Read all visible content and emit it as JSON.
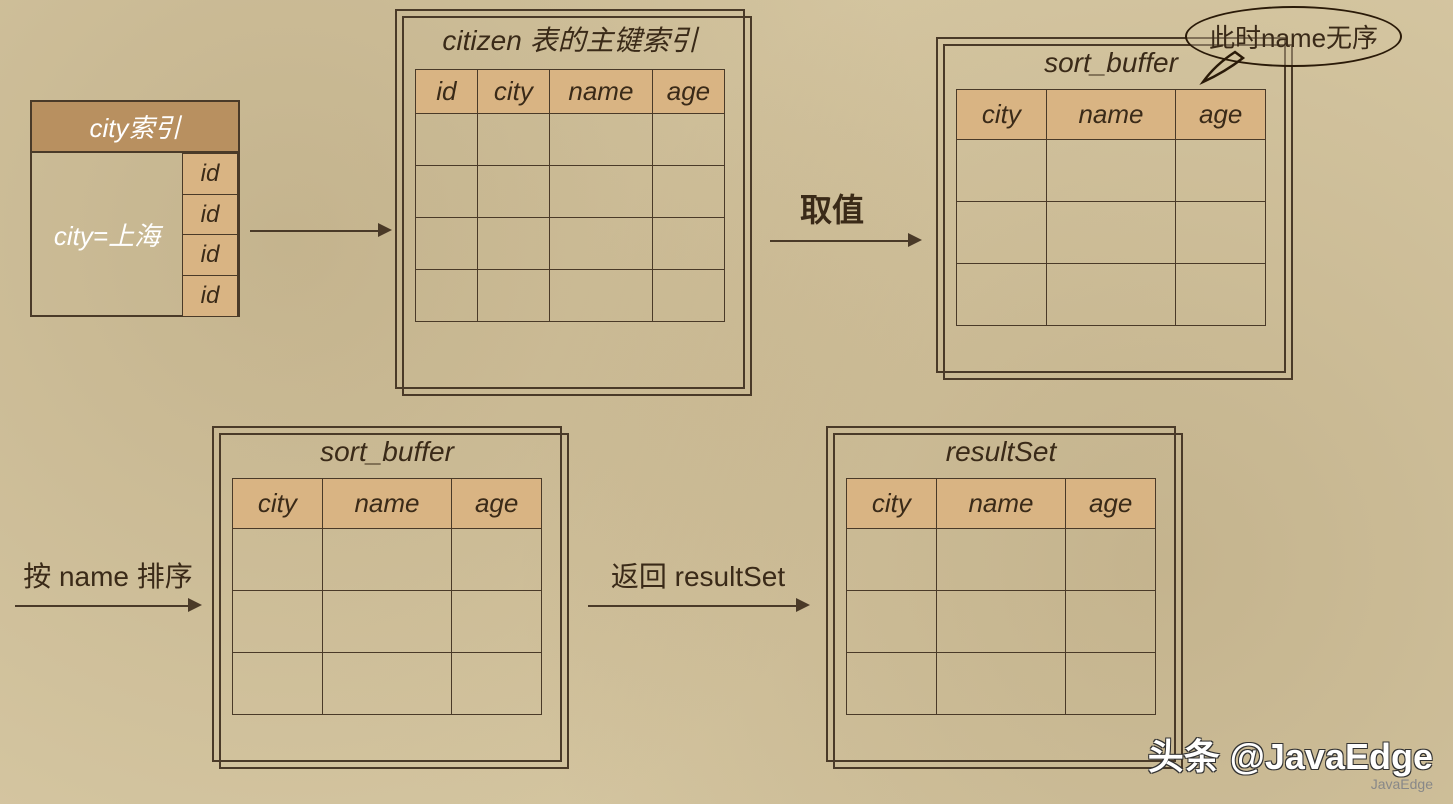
{
  "cityIndex": {
    "title": "city索引",
    "condition": "city=上海",
    "ids": [
      "id",
      "id",
      "id",
      "id"
    ]
  },
  "primaryIndex": {
    "title": "citizen 表的主键索引",
    "headers": [
      "id",
      "city",
      "name",
      "age"
    ]
  },
  "sortBuffer1": {
    "title": "sort_buffer",
    "headers": [
      "city",
      "name",
      "age"
    ],
    "note": "此时name无序"
  },
  "sortBuffer2": {
    "title": "sort_buffer",
    "headers": [
      "city",
      "name",
      "age"
    ]
  },
  "resultSet": {
    "title": "resultSet",
    "headers": [
      "city",
      "name",
      "age"
    ]
  },
  "arrows": {
    "a1": "",
    "a2": "取值",
    "a3": "按 name 排序",
    "a4": "返回 resultSet"
  },
  "watermark": {
    "main": "头条 @JavaEdge",
    "sub": "JavaEdge"
  }
}
